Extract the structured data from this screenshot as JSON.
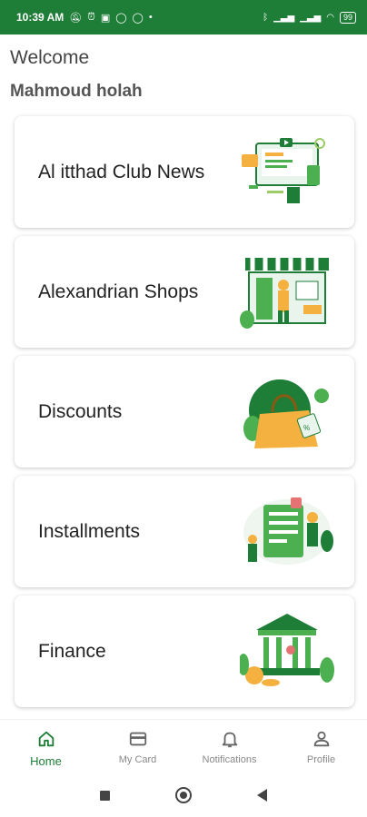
{
  "status_bar": {
    "time": "10:39 AM",
    "left_icons": [
      "mute-icon",
      "alarm-icon",
      "teams-icon",
      "whatsapp-icon",
      "whatsapp-icon"
    ],
    "battery": "99"
  },
  "header": {
    "welcome": "Welcome",
    "user_name": "Mahmoud holah"
  },
  "cards": [
    {
      "title": "Al itthad Club News",
      "icon": "news-illustration-icon"
    },
    {
      "title": "Alexandrian Shops",
      "icon": "shop-illustration-icon"
    },
    {
      "title": "Discounts",
      "icon": "discount-bag-illustration-icon"
    },
    {
      "title": "Installments",
      "icon": "installments-illustration-icon"
    },
    {
      "title": "Finance",
      "icon": "bank-illustration-icon"
    }
  ],
  "bottom_nav": {
    "items": [
      {
        "label": "Home",
        "icon": "home-icon",
        "active": true
      },
      {
        "label": "My Card",
        "icon": "card-icon",
        "active": false
      },
      {
        "label": "Notifications",
        "icon": "bell-icon",
        "active": false
      },
      {
        "label": "Profile",
        "icon": "person-icon",
        "active": false
      }
    ]
  },
  "colors": {
    "brand_green": "#1e7d36",
    "accent_orange": "#f4b13f",
    "light_green": "#4caf50"
  }
}
